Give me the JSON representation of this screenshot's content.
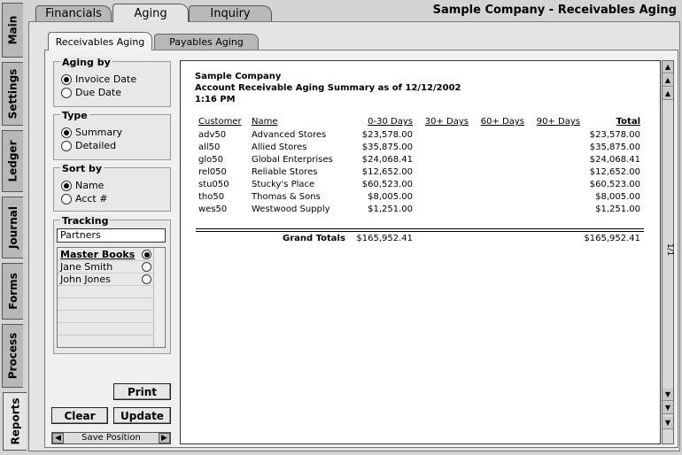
{
  "side_tabs": [
    "Main",
    "Settings",
    "Ledger",
    "Journal",
    "Forms",
    "Process",
    "Reports"
  ],
  "top_tabs": [
    "Financials",
    "Aging",
    "Inquiry"
  ],
  "window_title": "Sample Company - Receivables Aging",
  "sub_tabs": [
    "Receivables Aging",
    "Payables Aging"
  ],
  "aging_by": {
    "title": "Aging by",
    "options": [
      "Invoice Date",
      "Due Date"
    ],
    "selected": 0
  },
  "type": {
    "title": "Type",
    "options": [
      "Summary",
      "Detailed"
    ],
    "selected": 0
  },
  "sort_by": {
    "title": "Sort by",
    "options": [
      "Name",
      "Acct #"
    ],
    "selected": 0
  },
  "tracking": {
    "title": "Tracking",
    "field_value": "Partners",
    "items": [
      {
        "label": "Master Books",
        "selected": true
      },
      {
        "label": "Jane Smith",
        "selected": false
      },
      {
        "label": "John Jones",
        "selected": false
      }
    ]
  },
  "buttons": {
    "print": "Print",
    "clear": "Clear",
    "update": "Update",
    "save_position": "Save Position"
  },
  "report": {
    "company": "Sample Company",
    "heading": "Account Receivable Aging Summary as of 12/12/2002",
    "time": "1:16 PM",
    "columns": [
      "Customer",
      "Name",
      "0-30 Days",
      "30+ Days",
      "60+ Days",
      "90+ Days",
      "Total"
    ],
    "rows": [
      [
        "adv50",
        "Advanced Stores",
        "$23,578.00",
        "",
        "",
        "",
        "$23,578.00"
      ],
      [
        "all50",
        "Allied Stores",
        "$35,875.00",
        "",
        "",
        "",
        "$35,875.00"
      ],
      [
        "glo50",
        "Global Enterprises",
        "$24,068.41",
        "",
        "",
        "",
        "$24,068.41"
      ],
      [
        "rel050",
        "Reliable Stores",
        "$12,652.00",
        "",
        "",
        "",
        "$12,652.00"
      ],
      [
        "stu050",
        "Stucky's Place",
        "$60,523.00",
        "",
        "",
        "",
        "$60,523.00"
      ],
      [
        "tho50",
        "Thomas & Sons",
        "$8,005.00",
        "",
        "",
        "",
        "$8,005.00"
      ],
      [
        "wes50",
        "Westwood Supply",
        "$1,251.00",
        "",
        "",
        "",
        "$1,251.00"
      ]
    ],
    "grand_totals_label": "Grand Totals",
    "grand_total_0_30": "$165,952.41",
    "grand_total": "$165,952.41"
  },
  "page_indicator": "1/1"
}
